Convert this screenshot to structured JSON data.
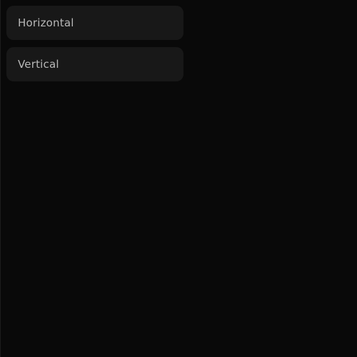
{
  "options": {
    "items": [
      {
        "label": "Horizontal"
      },
      {
        "label": "Vertical"
      }
    ]
  },
  "colors": {
    "background": "#090909",
    "item_background": "#181818",
    "item_text": "#b8b8b8"
  }
}
